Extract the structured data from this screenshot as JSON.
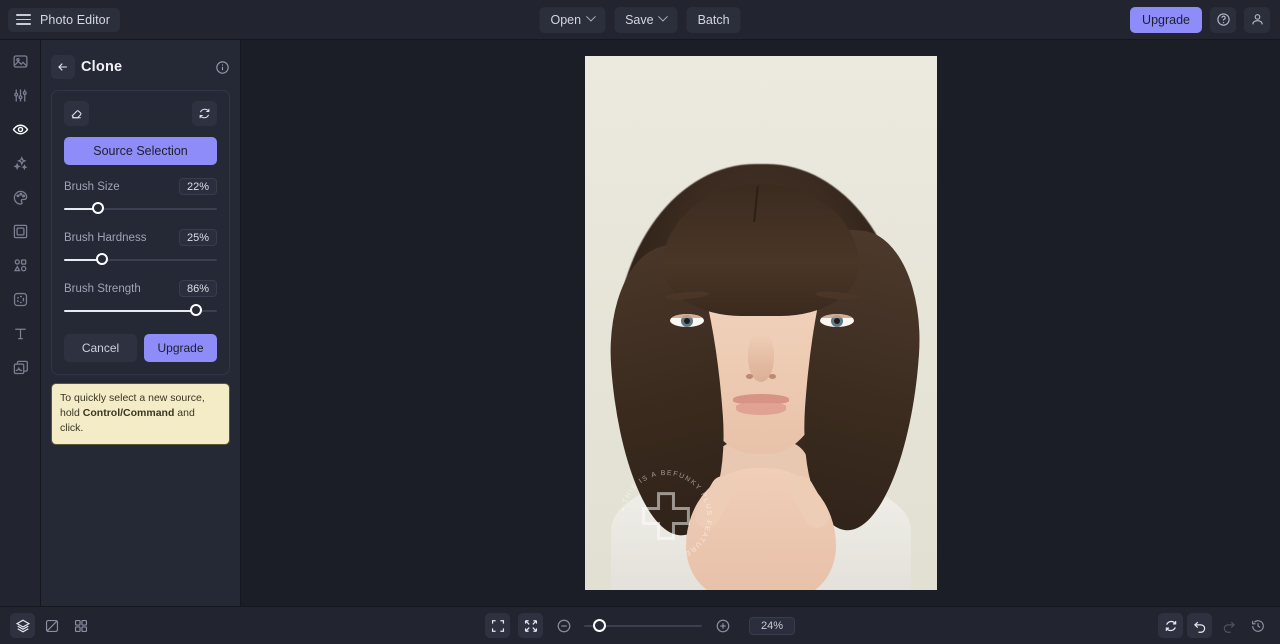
{
  "app": {
    "title": "Photo Editor",
    "accent_color": "#8d8cf8",
    "panel_bg": "#252835",
    "canvas_bg": "#1b1d27"
  },
  "topbar": {
    "menu_icon": "hamburger-icon",
    "brand_label": "Photo Editor",
    "open_label": "Open",
    "save_label": "Save",
    "batch_label": "Batch",
    "upgrade_label": "Upgrade",
    "help_icon": "help-circle-icon",
    "account_icon": "user-icon"
  },
  "rail": {
    "items": [
      {
        "icon": "image-icon",
        "name": "sidebar-item-image",
        "active": false
      },
      {
        "icon": "sliders-icon",
        "name": "sidebar-item-edit",
        "active": false
      },
      {
        "icon": "eye-icon",
        "name": "sidebar-item-touchup",
        "active": true
      },
      {
        "icon": "sparkles-icon",
        "name": "sidebar-item-effects",
        "active": false
      },
      {
        "icon": "palette-icon",
        "name": "sidebar-item-artsy",
        "active": false
      },
      {
        "icon": "frame-icon",
        "name": "sidebar-item-frames",
        "active": false
      },
      {
        "icon": "shapes-icon",
        "name": "sidebar-item-graphics",
        "active": false
      },
      {
        "icon": "sticker-icon",
        "name": "sidebar-item-overlays",
        "active": false
      },
      {
        "icon": "text-icon",
        "name": "sidebar-item-text",
        "active": false
      },
      {
        "icon": "layers-copy-icon",
        "name": "sidebar-item-textures",
        "active": false
      }
    ]
  },
  "panel": {
    "back_icon": "arrow-left-icon",
    "title": "Clone",
    "info_icon": "info-circle-icon",
    "eraser_icon": "eraser-icon",
    "reset_icon": "reset-icon",
    "source_selection_label": "Source Selection",
    "sliders": [
      {
        "label": "Brush Size",
        "value": "22%",
        "percent": 22
      },
      {
        "label": "Brush Hardness",
        "value": "25%",
        "percent": 25
      },
      {
        "label": "Brush Strength",
        "value": "86%",
        "percent": 86
      }
    ],
    "cancel_label": "Cancel",
    "upgrade_label": "Upgrade",
    "tooltip": {
      "text_before": "To quickly select a new source, hold ",
      "bold": "Control/Command",
      "text_after": " and click."
    }
  },
  "canvas": {
    "watermark_text": "• THIS IS A BEFUNKY PLUS FEATURE ",
    "watermark_symbol": "plus-icon"
  },
  "bottombar": {
    "layers_icon": "layers-icon",
    "compare_icon": "compare-icon",
    "grid_icon": "grid-icon",
    "fit_screen_icon": "fit-screen-icon",
    "fit_window_icon": "fit-window-icon",
    "zoom_out_icon": "zoom-out-icon",
    "zoom_in_icon": "zoom-in-icon",
    "zoom_value": "24%",
    "zoom_percent": 13,
    "reset_icon": "reset-icon",
    "undo_icon": "undo-icon",
    "redo_icon": "redo-icon",
    "history_icon": "history-icon"
  }
}
